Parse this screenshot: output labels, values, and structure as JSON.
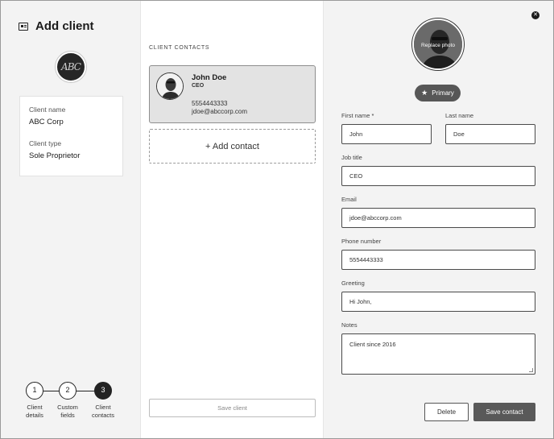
{
  "left": {
    "title": "Add client",
    "logo_text": "ABC",
    "client_name_label": "Client name",
    "client_name_value": "ABC Corp",
    "client_type_label": "Client type",
    "client_type_value": "Sole Proprietor",
    "steps": [
      {
        "number": "1",
        "line1": "Client",
        "line2": "details"
      },
      {
        "number": "2",
        "line1": "Custom",
        "line2": "fields"
      },
      {
        "number": "3",
        "line1": "Client",
        "line2": "contacts"
      }
    ],
    "active_step": 3
  },
  "middle": {
    "section_title": "CLIENT CONTACTS",
    "contact": {
      "name": "John Doe",
      "title": "CEO",
      "phone": "5554443333",
      "email": "jdoe@abccorp.com"
    },
    "add_contact_label": "+ Add contact",
    "save_client_label": "Save client"
  },
  "right": {
    "photo_label": "Replace photo",
    "primary_label": "Primary",
    "first_name_label": "First name",
    "required_mark": "*",
    "first_name_value": "John",
    "last_name_label": "Last name",
    "last_name_value": "Doe",
    "job_title_label": "Job title",
    "job_title_value": "CEO",
    "email_label": "Email",
    "email_value": "jdoe@abccorp.com",
    "phone_label": "Phone number",
    "phone_value": "5554443333",
    "greeting_label": "Greeting",
    "greeting_value": "Hi John,",
    "notes_label": "Notes",
    "notes_value": "Client since 2016",
    "delete_label": "Delete",
    "save_contact_label": "Save contact",
    "close_glyph": "✕"
  },
  "colors": {
    "panel_gray": "#f3f3f3",
    "selected_card": "#e3e3e3",
    "primary_button": "#595959",
    "text_dark": "#1b1b1b"
  }
}
